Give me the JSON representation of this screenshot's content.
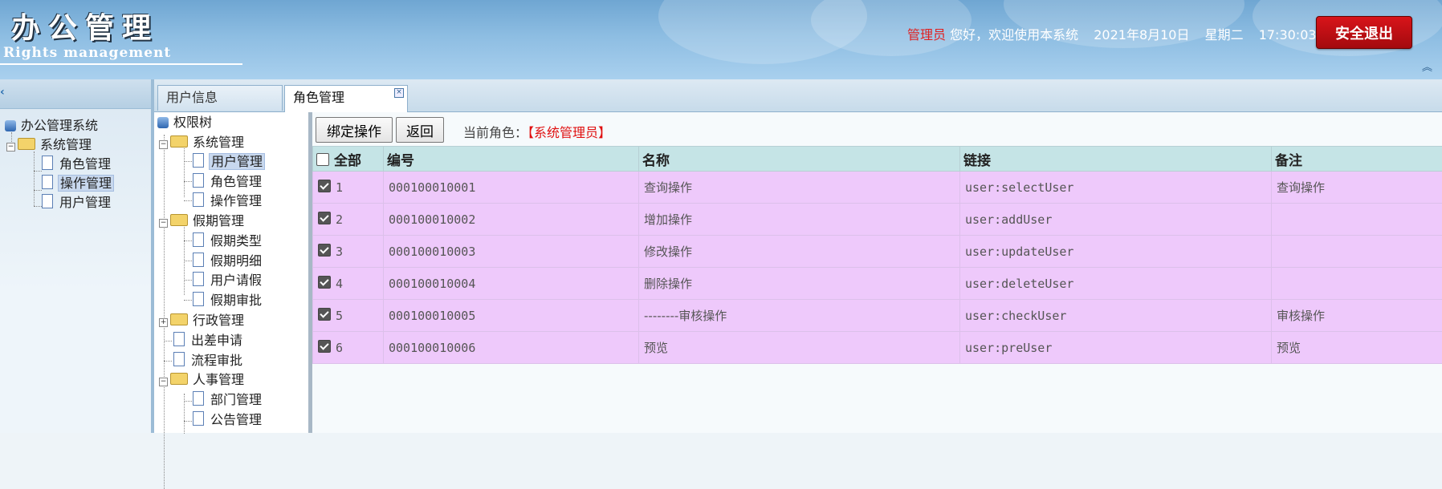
{
  "header": {
    "title": "办公管理",
    "subtitle": "Rights management",
    "user": "管理员",
    "greeting": "您好，欢迎使用本系统",
    "date": "2021年8月10日",
    "weekday": "星期二",
    "time": "17:30:03",
    "logout_label": "安全退出"
  },
  "left_nav": {
    "root": "办公管理系统",
    "group": "系统管理",
    "items": [
      "角色管理",
      "操作管理",
      "用户管理"
    ],
    "selected": "操作管理"
  },
  "tabs": [
    {
      "label": "用户信息",
      "active": false
    },
    {
      "label": "角色管理",
      "active": true
    }
  ],
  "permission_tree": {
    "root": "权限树",
    "nodes": [
      {
        "label": "系统管理",
        "type": "folder",
        "expanded": true
      },
      {
        "label": "用户管理",
        "type": "page",
        "selected": true
      },
      {
        "label": "角色管理",
        "type": "page"
      },
      {
        "label": "操作管理",
        "type": "page"
      },
      {
        "label": "假期管理",
        "type": "folder",
        "expanded": true
      },
      {
        "label": "假期类型",
        "type": "page"
      },
      {
        "label": "假期明细",
        "type": "page"
      },
      {
        "label": "用户请假",
        "type": "page"
      },
      {
        "label": "假期审批",
        "type": "page"
      },
      {
        "label": "行政管理",
        "type": "folder",
        "expanded": false
      },
      {
        "label": "出差申请",
        "type": "page"
      },
      {
        "label": "流程审批",
        "type": "page"
      },
      {
        "label": "人事管理",
        "type": "folder",
        "expanded": true
      },
      {
        "label": "部门管理",
        "type": "page"
      },
      {
        "label": "公告管理",
        "type": "page"
      }
    ]
  },
  "toolbar": {
    "bind_label": "绑定操作",
    "back_label": "返回",
    "current_role_label": "当前角色：",
    "current_role_value": "【系统管理员】"
  },
  "table": {
    "columns": {
      "select_all": "全部",
      "code": "编号",
      "name": "名称",
      "link": "链接",
      "remark": "备注"
    },
    "rows": [
      {
        "idx": "1",
        "checked": true,
        "code": "000100010001",
        "name": "查询操作",
        "link": "user:selectUser",
        "remark": "查询操作"
      },
      {
        "idx": "2",
        "checked": true,
        "code": "000100010002",
        "name": "增加操作",
        "link": "user:addUser",
        "remark": ""
      },
      {
        "idx": "3",
        "checked": true,
        "code": "000100010003",
        "name": "修改操作",
        "link": "user:updateUser",
        "remark": ""
      },
      {
        "idx": "4",
        "checked": true,
        "code": "000100010004",
        "name": "删除操作",
        "link": "user:deleteUser",
        "remark": ""
      },
      {
        "idx": "5",
        "checked": true,
        "code": "000100010005",
        "name": "--------审核操作",
        "link": "user:checkUser",
        "remark": "审核操作"
      },
      {
        "idx": "6",
        "checked": true,
        "code": "000100010006",
        "name": "预览",
        "link": "user:preUser",
        "remark": "预览"
      }
    ]
  }
}
